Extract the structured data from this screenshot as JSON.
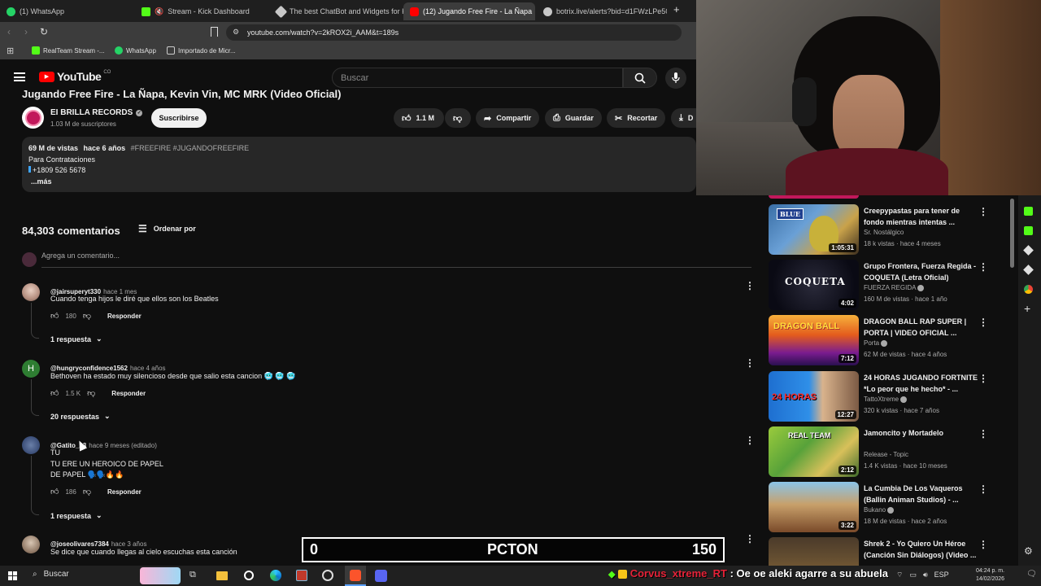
{
  "browser": {
    "tabs": [
      {
        "label": "(1) WhatsApp",
        "icon_color": "#25d366"
      },
      {
        "label": "Stream - Kick Dashboard",
        "icon_color": "#53fc18"
      },
      {
        "label": "The best ChatBot and Widgets for Ki",
        "icon_color": "#c7c7c7"
      },
      {
        "label": "(12) Jugando Free Fire - La Ñapa",
        "icon_color": "#ff0000"
      },
      {
        "label": "botrix.live/alerts?bid=d1FWzLPe50H",
        "icon_color": "#c7c7c7"
      }
    ],
    "new_tab": "+",
    "url": "youtube.com/watch?v=2kROX2i_AAM&t=189s",
    "bookmarks": [
      "RealTeam Stream -...",
      "WhatsApp",
      "Importado de Micr..."
    ]
  },
  "youtube": {
    "logo_text": "YouTube",
    "country_code": "CO",
    "search_placeholder": "Buscar",
    "video_title": "Jugando Free Fire - La Ñapa, Kevin Vin, MC MRK (Video Oficial)",
    "channel": {
      "name": "EI BRILLA RECORDS",
      "subscribers": "1.03 M de suscriptores",
      "subscribe_label": "Suscribirse"
    },
    "actions": {
      "likes": "1.1 M",
      "share": "Compartir",
      "save": "Guardar",
      "clip": "Recortar",
      "download": "D"
    },
    "description": {
      "views": "69 M de vistas",
      "age": "hace 6 años",
      "tags": "#FREEFIRE #JUGANDOFREEFIRE",
      "line1": "Para Contrataciones",
      "line2": "+1809 526 5678",
      "more": "...más"
    },
    "comments": {
      "count_label": "84,303 comentarios",
      "sort_label": "Ordenar por",
      "add_placeholder": "Agrega un comentario...",
      "reply_label": "Responder",
      "items": [
        {
          "author": "@jairsuperyt330",
          "time": "hace 1 mes",
          "text": "Cuando tenga hijos le diré que ellos son los Beatles",
          "likes": "180",
          "replies": "1 respuesta"
        },
        {
          "author": "@hungryconfidence1562",
          "time": "hace 4 años",
          "text": "Bethoven ha estado muy silencioso desde que salio esta cancion 🥶 🥶 🥶",
          "likes": "1.5 K",
          "replies": "20 respuestas",
          "avatar_letter": "H"
        },
        {
          "author": "@Gatito_23",
          "time": "hace 9 meses (editado)",
          "text_lines": [
            "TU",
            "TU ERE UN HEROICO DE PAPEL",
            "DE PAPEL 🗣️🗣️🔥🔥"
          ],
          "likes": "186",
          "replies": "1 respuesta"
        },
        {
          "author": "@joseolivares7384",
          "time": "hace 3 años",
          "text": "Se dice que cuando llegas al cielo escuchas esta canción"
        }
      ]
    },
    "recommendations": [
      {
        "title": "Creepypastas para tener de fondo mientras intentas ...",
        "channel": "Sr. Nostálgico",
        "stats": "18 k vistas · hace 4 meses",
        "duration": "1:05:31",
        "thumb_text": "BLUE",
        "verified": false
      },
      {
        "title": "Grupo Frontera, Fuerza Regida - COQUETA (Letra Oficial)",
        "channel": "FUERZA REGIDA",
        "stats": "160 M de vistas · hace 1 año",
        "duration": "4:02",
        "thumb_text": "COQUETA",
        "verified": true
      },
      {
        "title": "DRAGON BALL RAP SUPER | PORTA | VIDEO OFICIAL ...",
        "channel": "Porta",
        "stats": "62 M de vistas · hace 4 años",
        "duration": "7:12",
        "thumb_text": "DRAGON BALL",
        "verified": true
      },
      {
        "title": "24 HORAS JUGANDO FORTNITE *Lo peor que he hecho* - ...",
        "channel": "TattoXtreme",
        "stats": "320 k vistas · hace 7 años",
        "duration": "12:27",
        "thumb_text": "24 HORAS",
        "verified": true
      },
      {
        "title": "Jamoncito y Mortadelo",
        "channel": "Release - Topic",
        "stats": "1.4 K vistas · hace 10 meses",
        "duration": "2:12",
        "thumb_text": "REAL TEAM",
        "verified": false
      },
      {
        "title": "La Cumbia De Los Vaqueros (Ballin Animan Studios) - ...",
        "channel": "Bukano",
        "stats": "18 M de vistas · hace 2 años",
        "duration": "3:22",
        "thumb_text": "",
        "verified": true
      },
      {
        "title": "Shrek 2 - Yo Quiero Un Héroe (Canción Sin Diálogos) (Video ...",
        "channel": "",
        "stats": "",
        "duration": "",
        "thumb_text": "",
        "verified": false
      }
    ]
  },
  "overlay": {
    "left_score": "0",
    "center_label": "PCTON",
    "right_score": "150"
  },
  "chat": {
    "user": "Corvus_xtreme_RT",
    "message": ": Oe oe aleki agarre a su abuela"
  },
  "taskbar": {
    "search_label": "Buscar",
    "lang": "ESP",
    "time": "04:24 p. m.",
    "date": "14/02/2026"
  },
  "colors": {
    "youtube_red": "#ff0000",
    "kick_green": "#53fc18",
    "chat_user": "#e52238"
  }
}
